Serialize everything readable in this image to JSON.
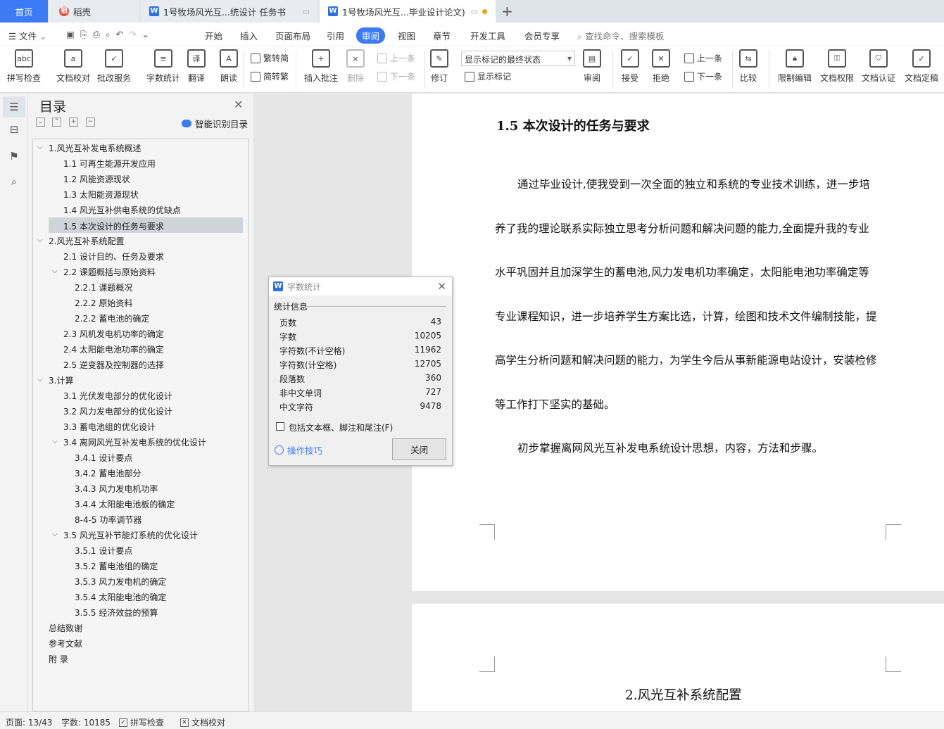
{
  "tabs": {
    "home": "首页",
    "wps": "稻壳",
    "doc1": "1号牧场风光互...统设计 任务书",
    "doc2": "1号牧场风光互...毕业设计论文)"
  },
  "menu": {
    "file": "文件",
    "items": [
      "开始",
      "插入",
      "页面布局",
      "引用",
      "审阅",
      "视图",
      "章节",
      "开发工具",
      "会员专享"
    ],
    "active": "审阅",
    "search": "查找命令、搜索模板"
  },
  "ribbon": {
    "spell": "拼写检查",
    "proof": "文档校对",
    "batch": "批改服务",
    "wordcount": "字数统计",
    "translate": "翻译",
    "read": "朗读",
    "trad": "繁转简",
    "simp": "简转繁",
    "insert_comment": "插入批注",
    "delete": "删除",
    "prev": "上一条",
    "next": "下一条",
    "revise": "修订",
    "markup_state": "显示标记的最终状态",
    "show_markup": "显示标记",
    "review": "审阅",
    "accept": "接受",
    "reject": "拒绝",
    "prev2": "上一条",
    "next2": "下一条",
    "compare": "比较",
    "restrict": "限制编辑",
    "perm": "文档权限",
    "cert": "文档认证",
    "final": "文档定稿"
  },
  "toc": {
    "title": "目录",
    "smart": "智能识别目录",
    "items": [
      "1.风光互补发电系统概述",
      "1.1  可再生能源开发应用",
      "1.2  风能资源现状",
      "1.3  太阳能资源现状",
      "1.4  风光互补供电系统的优缺点",
      "1.5 本次设计的任务与要求",
      "2.风光互补系统配置",
      "2.1 设计目的、任务及要求",
      "2.2 课题概括与原始资料",
      "2.2.1 课题概况",
      "2.2.2 原始资料",
      "2.2.2 蓄电池的确定",
      "2.3 风机发电机功率的确定",
      "2.4 太阳能电池功率的确定",
      "2.5 逆变器及控制器的选择",
      "3.计算",
      "3.1 光伏发电部分的优化设计",
      "3.2 风力发电部分的优化设计",
      "3.3 蓄电池组的优化设计",
      "3.4  离网风光互补发电系统的优化设计",
      "3.4.1 设计要点",
      "3.4.2 蓄电池部分",
      "3.4.3 风力发电机功率",
      "3.4.4 太阳能电池板的确定",
      "8-4-5 功率调节器",
      "3.5  风光互补节能灯系统的优化设计",
      "3.5.1 设计要点",
      "3.5.2 蓄电池组的确定",
      "3.5.3 风力发电机的确定",
      "3.5.4 太阳能电池的确定",
      "3.5.5 经济效益的预算",
      "总结致谢",
      "参考文献",
      "附  录"
    ]
  },
  "document": {
    "heading": "1.5 本次设计的任务与要求",
    "lines": [
      "通过毕业设计,使我受到一次全面的独立和系统的专业技术训练，进一步培",
      "养了我的理论联系实际独立思考分析问题和解决问题的能力,全面提升我的专业",
      "水平巩固并且加深学生的蓄电池,风力发电机功率确定，太阳能电池功率确定等",
      "专业课程知识，进一步培养学生方案比选，计算，绘图和技术文件编制技能，提",
      "高学生分析问题和解决问题的能力，为学生今后从事新能源电站设计，安装检修",
      "等工作打下坚实的基础。",
      "初步掌握离网风光互补发电系统设计思想，内容，方法和步骤。"
    ],
    "next_heading": "2.风光互补系统配置"
  },
  "dialog": {
    "title": "字数统计",
    "section": "统计信息",
    "stats": [
      {
        "label": "页数",
        "value": "43"
      },
      {
        "label": "字数",
        "value": "10205"
      },
      {
        "label": "字符数(不计空格)",
        "value": "11962"
      },
      {
        "label": "字符数(计空格)",
        "value": "12705"
      },
      {
        "label": "段落数",
        "value": "360"
      },
      {
        "label": "非中文单词",
        "value": "727"
      },
      {
        "label": "中文字符",
        "value": "9478"
      }
    ],
    "checkbox": "包括文本框、脚注和尾注(F)",
    "tips": "操作技巧",
    "close": "关闭"
  },
  "status": {
    "page": "页面: 13/43",
    "words": "字数: 10185",
    "spell": "拼写检查",
    "proof": "文档校对"
  }
}
